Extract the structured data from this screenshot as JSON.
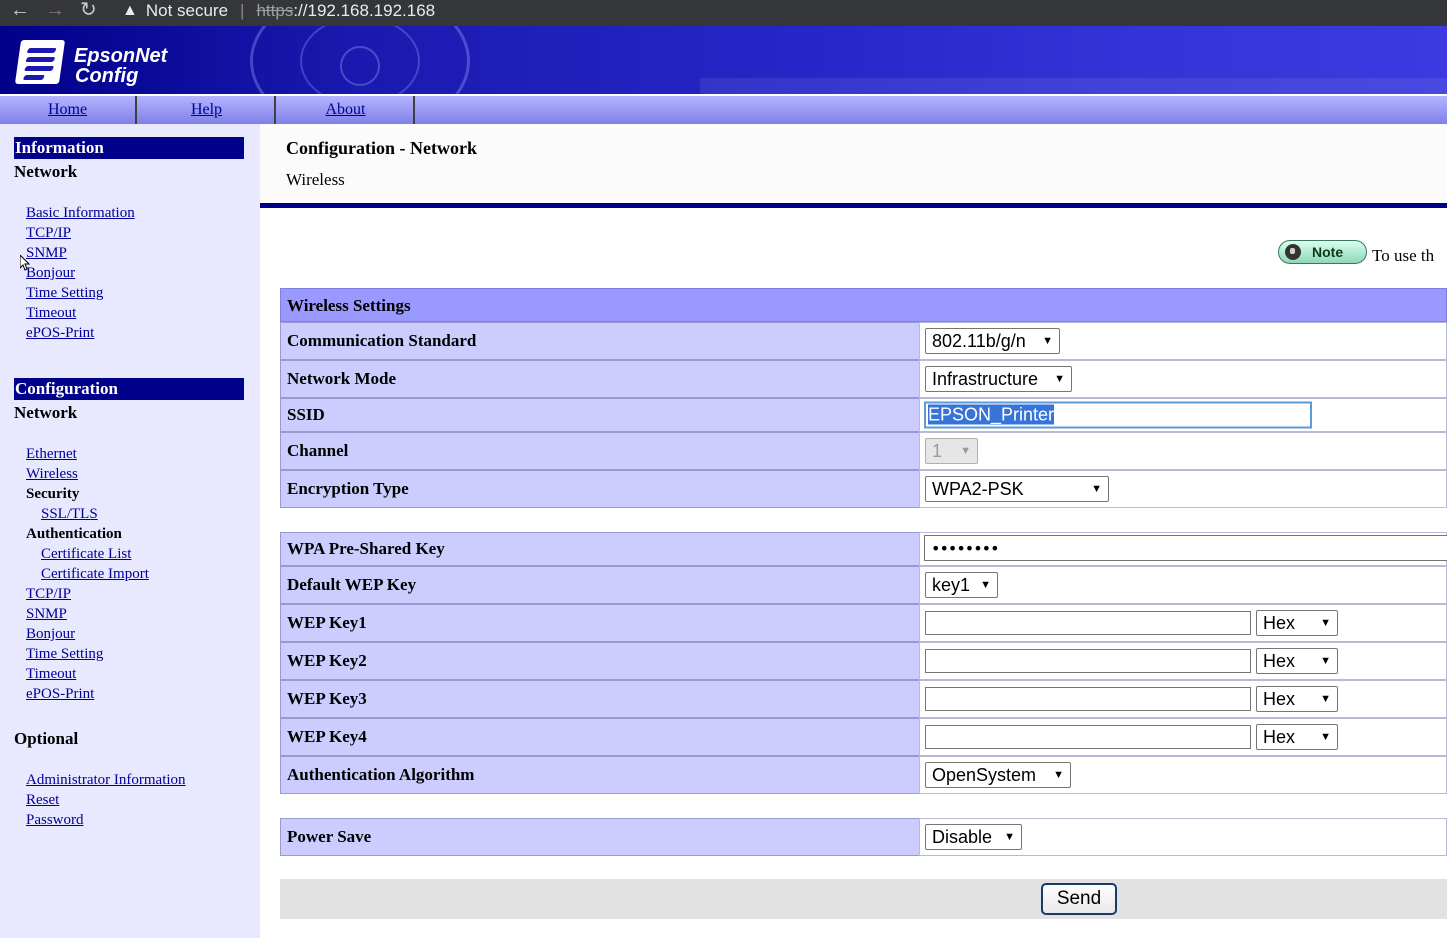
{
  "browser": {
    "back_icon": "←",
    "forward_icon": "→",
    "reload_icon": "↻",
    "warning_icon": "▲",
    "security_label": "Not secure",
    "url_scheme": "https",
    "url_host": "://192.168.192.168"
  },
  "banner": {
    "logo_line1": "EpsonNet",
    "logo_line2": "Config"
  },
  "menu": {
    "home": "Home",
    "help": "Help",
    "about": "About"
  },
  "sidebar": {
    "information_header": "Information",
    "info_network_label": "Network",
    "info_links": [
      "Basic Information",
      "TCP/IP",
      "SNMP",
      "Bonjour",
      "Time Setting",
      "Timeout",
      "ePOS-Print"
    ],
    "configuration_header": "Configuration",
    "config_network_label": "Network",
    "config_ethernet": "Ethernet",
    "config_wireless": "Wireless",
    "config_security": "Security",
    "config_ssl": "SSL/TLS",
    "config_authentication": "Authentication",
    "config_cert_list": "Certificate List",
    "config_cert_import": "Certificate Import",
    "config_links": [
      "TCP/IP",
      "SNMP",
      "Bonjour",
      "Time Setting",
      "Timeout",
      "ePOS-Print"
    ],
    "optional_label": "Optional",
    "optional_links": [
      "Administrator Information",
      "Reset",
      "Password"
    ]
  },
  "content": {
    "title": "Configuration - Network",
    "subtitle": "Wireless",
    "note_badge": "Note",
    "note_text": "To use th"
  },
  "form": {
    "section_title": "Wireless Settings",
    "communication_standard": {
      "label": "Communication Standard",
      "value": "802.11b/g/n"
    },
    "network_mode": {
      "label": "Network Mode",
      "value": "Infrastructure"
    },
    "ssid": {
      "label": "SSID",
      "value": "EPSON_Printer"
    },
    "channel": {
      "label": "Channel",
      "value": "1"
    },
    "encryption_type": {
      "label": "Encryption Type",
      "value": "WPA2-PSK"
    },
    "wpa_key": {
      "label": "WPA Pre-Shared Key",
      "value": "••••••••"
    },
    "default_wep_key": {
      "label": "Default WEP Key",
      "value": "key1"
    },
    "wep_keys": [
      {
        "label": "WEP Key1",
        "value": "",
        "format": "Hex"
      },
      {
        "label": "WEP Key2",
        "value": "",
        "format": "Hex"
      },
      {
        "label": "WEP Key3",
        "value": "",
        "format": "Hex"
      },
      {
        "label": "WEP Key4",
        "value": "",
        "format": "Hex"
      }
    ],
    "auth_algorithm": {
      "label": "Authentication Algorithm",
      "value": "OpenSystem"
    },
    "power_save": {
      "label": "Power Save",
      "value": "Disable"
    },
    "send_label": "Send",
    "dropdown_arrow": "▼"
  },
  "colors": {
    "banner_blue": "#00008a",
    "label_bg": "#ccccff",
    "header_bg": "#9999ff",
    "sidebar_bg": "#e8e8ff"
  }
}
